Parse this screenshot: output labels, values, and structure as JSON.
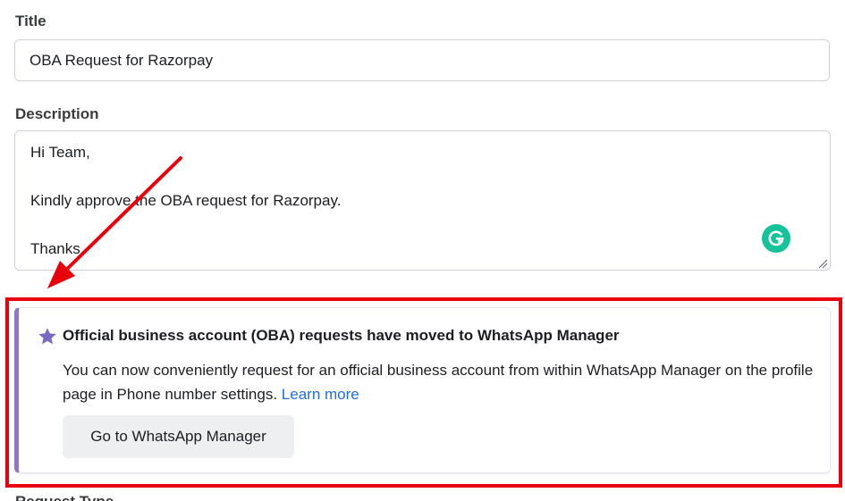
{
  "form": {
    "title_label": "Title",
    "title_value": "OBA Request for Razorpay",
    "description_label": "Description",
    "description_lines": [
      "Hi Team,",
      "Kindly approve the OBA request for Razorpay.",
      "Thanks,"
    ],
    "next_field_label": "Request Type"
  },
  "notice": {
    "heading": "Official business account (OBA) requests have moved to WhatsApp Manager",
    "body": "You can now conveniently request for an official business account from within WhatsApp Manager on the profile page in Phone number settings.",
    "learn_more": "Learn more",
    "button_label": "Go to WhatsApp Manager",
    "accent_color": "#8c79c2"
  },
  "annotations": {
    "highlight_color": "#e8000b",
    "arrow_color": "#e8000b"
  },
  "icons": {
    "grammarly": "grammarly-icon",
    "notice": "star-icon",
    "resize": "resize-handle-icon"
  },
  "colors": {
    "link": "#216fdb",
    "grammarly": "#15c39a",
    "button_bg": "#eeeff1"
  }
}
